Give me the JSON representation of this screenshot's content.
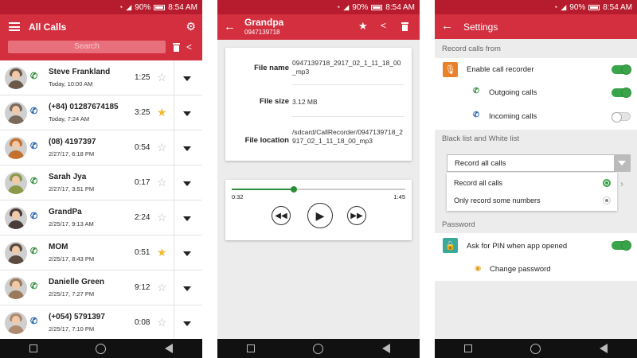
{
  "status": {
    "battery": "90%",
    "time": "8:54 AM"
  },
  "colors": {
    "primary": "#d32f3f",
    "status_bar": "#b71c2e",
    "outgoing": "#2e8b3a",
    "incoming": "#1f5fa8",
    "star_on": "#f2b92c",
    "toggle_on": "#3aa44a"
  },
  "all_calls": {
    "title": "All Calls",
    "search_placeholder": "Search",
    "calls": [
      {
        "name": "Steve Frankland",
        "date": "Today, 10:00 AM",
        "duration": "1:25",
        "direction": "outgoing",
        "starred": false,
        "avatar_color": "#6b5a4a"
      },
      {
        "name": "(+84) 01287674185",
        "date": "Today, 7:24 AM",
        "duration": "3:25",
        "direction": "incoming",
        "starred": true,
        "avatar_color": "#7a6a5c"
      },
      {
        "name": "(08) 4197397",
        "date": "2/27/17, 6:18 PM",
        "duration": "0:54",
        "direction": "incoming",
        "starred": false,
        "avatar_color": "#c4702e"
      },
      {
        "name": "Sarah Jya",
        "date": "2/27/17, 3:51 PM",
        "duration": "0:17",
        "direction": "outgoing",
        "starred": false,
        "avatar_color": "#8a9a4a"
      },
      {
        "name": "GrandPa",
        "date": "2/25/17, 9:13 AM",
        "duration": "2:24",
        "direction": "incoming",
        "starred": false,
        "avatar_color": "#4a3a3a"
      },
      {
        "name": "MOM",
        "date": "2/25/17, 8:43 PM",
        "duration": "0:51",
        "direction": "outgoing",
        "starred": true,
        "avatar_color": "#5a4a40"
      },
      {
        "name": "Danielle Green",
        "date": "2/25/17, 7:27 PM",
        "duration": "9:12",
        "direction": "outgoing",
        "starred": false,
        "avatar_color": "#9a7a5a"
      },
      {
        "name": "(+054) 5791397",
        "date": "2/25/17, 7:10 PM",
        "duration": "0:08",
        "direction": "incoming",
        "starred": false,
        "avatar_color": "#b08a70"
      }
    ]
  },
  "detail": {
    "title": "Grandpa",
    "subtitle": "0947139718",
    "file_name_label": "File name",
    "file_name": "0947139718_2917_02_1_11_18_00_mp3",
    "file_size_label": "File size",
    "file_size": "3.12 MB",
    "file_location_label": "File location",
    "file_location": "/sdcard/CallRecorder/0947139718_2917_02_1_11_18_00_mp3",
    "time_current": "0:32",
    "time_total": "1:45",
    "progress": 0.36
  },
  "settings": {
    "title": "Settings",
    "section_record": "Record calls from",
    "enable_recorder": "Enable call recorder",
    "enable_recorder_on": true,
    "outgoing_calls": "Outgoing calls",
    "outgoing_calls_on": true,
    "incoming_calls": "Incoming calls",
    "incoming_calls_on": false,
    "section_list": "Black list and White list",
    "dropdown_selected": "Record all calls",
    "options": [
      {
        "label": "Record all calls",
        "selected": true
      },
      {
        "label": "Only record some numbers",
        "selected": false
      }
    ],
    "section_password": "Password",
    "ask_pin": "Ask for PIN when app opened",
    "ask_pin_on": true,
    "change_password": "Change password"
  }
}
